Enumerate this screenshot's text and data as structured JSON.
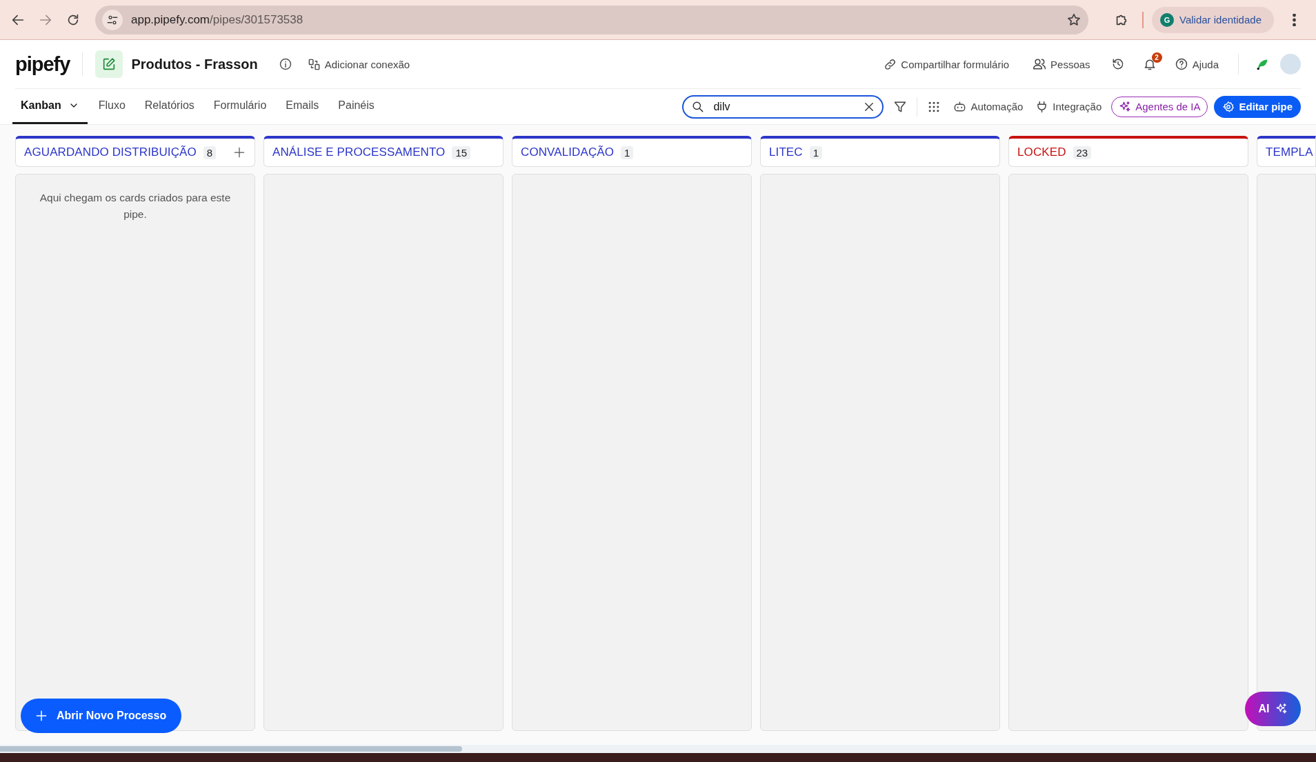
{
  "browser": {
    "url_host": "app.pipefy.com",
    "url_path": "/pipes/301573538",
    "profile_initial": "G",
    "profile_label": "Validar identidade"
  },
  "header": {
    "logo": "pipefy",
    "title": "Produtos - Frasson",
    "connection": "Adicionar conexão",
    "share": "Compartilhar formulário",
    "people": "Pessoas",
    "notification_count": "2",
    "help": "Ajuda"
  },
  "tabs": [
    {
      "label": "Kanban",
      "selected": true,
      "has_menu": true
    },
    {
      "label": "Fluxo",
      "selected": false,
      "has_menu": false
    },
    {
      "label": "Relatórios",
      "selected": false,
      "has_menu": false
    },
    {
      "label": "Formulário",
      "selected": false,
      "has_menu": false
    },
    {
      "label": "Emails",
      "selected": false,
      "has_menu": false
    },
    {
      "label": "Painéis",
      "selected": false,
      "has_menu": false
    }
  ],
  "search": {
    "value": "dilv"
  },
  "toolbar": {
    "automation": "Automação",
    "integration": "Integração",
    "agents": "Agentes de IA",
    "edit": "Editar pipe"
  },
  "columns": [
    {
      "title": "AGUARDANDO DISTRIBUIÇÃO",
      "count": "8",
      "color": "#2b35c9",
      "addable": true,
      "empty_message": "Aqui chegam os cards criados para este pipe."
    },
    {
      "title": "ANÁLISE E PROCESSAMENTO",
      "count": "15",
      "color": "#2b35c9",
      "addable": false
    },
    {
      "title": "CONVALIDAÇÃO",
      "count": "1",
      "color": "#2b35c9",
      "addable": false
    },
    {
      "title": "LITEC",
      "count": "1",
      "color": "#2b35c9",
      "addable": false
    },
    {
      "title": "LOCKED",
      "count": "23",
      "color": "#c8120f",
      "addable": false
    },
    {
      "title": "TEMPLA",
      "color": "#2b35c9"
    }
  ],
  "new_process_button": {
    "label": "Abrir Novo Processo"
  },
  "ai_button": {
    "label": "AI"
  }
}
